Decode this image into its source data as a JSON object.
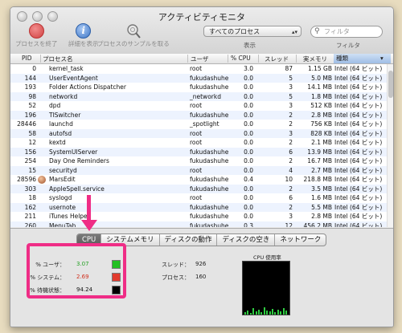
{
  "window": {
    "title": "アクティビティモニタ"
  },
  "toolbar": {
    "quit_label": "プロセスを終了",
    "inspect_label": "詳細を表示",
    "sample_label": "プロセスのサンプルを取る",
    "view_select": "すべてのプロセス",
    "view_caption": "表示",
    "filter_placeholder": "フィルタ",
    "filter_caption": "フィルタ"
  },
  "table": {
    "headers": {
      "pid": "PID",
      "name": "プロセス名",
      "user": "ユーザ",
      "cpu": "% CPU",
      "threads": "スレッド",
      "mem": "実メモリ",
      "kind": "種類"
    },
    "rows": [
      {
        "pid": "0",
        "name": "kernel_task",
        "user": "root",
        "cpu": "3.0",
        "threads": "87",
        "mem": "1.15 GB",
        "kind": "Intel (64 ビット)"
      },
      {
        "pid": "144",
        "name": "UserEventAgent",
        "user": "fukudashuhe",
        "cpu": "0.0",
        "threads": "5",
        "mem": "5.0 MB",
        "kind": "Intel (64 ビット)"
      },
      {
        "pid": "193",
        "name": "Folder Actions Dispatcher",
        "user": "fukudashuhe",
        "cpu": "0.0",
        "threads": "3",
        "mem": "14.1 MB",
        "kind": "Intel (64 ビット)"
      },
      {
        "pid": "98",
        "name": "networkd",
        "user": "_networkd",
        "cpu": "0.0",
        "threads": "5",
        "mem": "1.8 MB",
        "kind": "Intel (64 ビット)"
      },
      {
        "pid": "52",
        "name": "dpd",
        "user": "root",
        "cpu": "0.0",
        "threads": "3",
        "mem": "512 KB",
        "kind": "Intel (64 ビット)"
      },
      {
        "pid": "196",
        "name": "TISwitcher",
        "user": "fukudashuhe",
        "cpu": "0.0",
        "threads": "2",
        "mem": "2.8 MB",
        "kind": "Intel (64 ビット)"
      },
      {
        "pid": "28446",
        "name": "launchd",
        "user": "_spotlight",
        "cpu": "0.0",
        "threads": "2",
        "mem": "756 KB",
        "kind": "Intel (64 ビット)"
      },
      {
        "pid": "58",
        "name": "autofsd",
        "user": "root",
        "cpu": "0.0",
        "threads": "3",
        "mem": "828 KB",
        "kind": "Intel (64 ビット)"
      },
      {
        "pid": "12",
        "name": "kextd",
        "user": "root",
        "cpu": "0.0",
        "threads": "2",
        "mem": "2.1 MB",
        "kind": "Intel (64 ビット)"
      },
      {
        "pid": "156",
        "name": "SystemUIServer",
        "user": "fukudashuhe",
        "cpu": "0.0",
        "threads": "6",
        "mem": "13.9 MB",
        "kind": "Intel (64 ビット)"
      },
      {
        "pid": "254",
        "name": "Day One Reminders",
        "user": "fukudashuhe",
        "cpu": "0.0",
        "threads": "2",
        "mem": "16.7 MB",
        "kind": "Intel (64 ビット)"
      },
      {
        "pid": "15",
        "name": "securityd",
        "user": "root",
        "cpu": "0.0",
        "threads": "4",
        "mem": "2.7 MB",
        "kind": "Intel (64 ビット)"
      },
      {
        "pid": "28596",
        "name": "MarsEdit",
        "user": "fukudashuhe",
        "cpu": "0.4",
        "threads": "10",
        "mem": "218.8 MB",
        "kind": "Intel (64 ビット)"
      },
      {
        "pid": "303",
        "name": "AppleSpell.service",
        "user": "fukudashuhe",
        "cpu": "0.0",
        "threads": "2",
        "mem": "3.5 MB",
        "kind": "Intel (64 ビット)"
      },
      {
        "pid": "18",
        "name": "syslogd",
        "user": "root",
        "cpu": "0.0",
        "threads": "6",
        "mem": "1.6 MB",
        "kind": "Intel (64 ビット)"
      },
      {
        "pid": "162",
        "name": "usernote",
        "user": "fukudashuhe",
        "cpu": "0.0",
        "threads": "2",
        "mem": "5.5 MB",
        "kind": "Intel (64 ビット)"
      },
      {
        "pid": "211",
        "name": "iTunes Helper",
        "user": "fukudashuhe",
        "cpu": "0.0",
        "threads": "3",
        "mem": "2.8 MB",
        "kind": "Intel (64 ビット)"
      },
      {
        "pid": "260",
        "name": "MenuTab",
        "user": "fukudashuhe",
        "cpu": "0.3",
        "threads": "12",
        "mem": "456.2 MB",
        "kind": "Intel (64 ビット)"
      }
    ]
  },
  "tabs": [
    "CPU",
    "システムメモリ",
    "ディスクの動作",
    "ディスクの空き",
    "ネットワーク"
  ],
  "cpu_panel": {
    "user_label": "% ユーザ：",
    "user_value": "3.07",
    "user_color": "#22c022",
    "system_label": "% システム：",
    "system_value": "2.69",
    "system_color": "#e23b2e",
    "idle_label": "% 待機状態：",
    "idle_value": "94.24",
    "idle_color": "#000000",
    "threads_label": "スレッド：",
    "threads_value": "926",
    "processes_label": "プロセス：",
    "processes_value": "160",
    "graph_caption": "CPU 使用率"
  },
  "annotation": {
    "color": "#ef2d86"
  }
}
